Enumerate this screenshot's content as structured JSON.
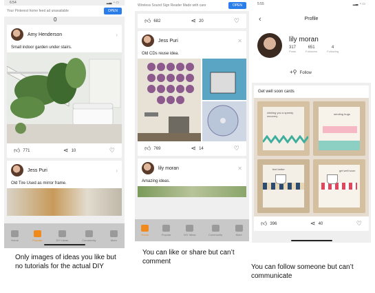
{
  "phone1": {
    "status_time": "6:54",
    "ad_text": "Your Pinterest home feed ad unavailable",
    "ad_button": "OPEN",
    "stray_char": "0",
    "post1": {
      "user": "Amy Henderson",
      "text": "Small indoor garden under stairs.",
      "likes": "771",
      "shares": "10"
    },
    "post2": {
      "user": "Jess Puri",
      "text": "Old Tire Used as mirror frame."
    },
    "tabs": [
      "Home",
      "Popular",
      "DIY Ideas",
      "Community",
      "More"
    ],
    "caption": "Only images of ideas you like but no tutorials for the actual DIY"
  },
  "phone2": {
    "ad_text": "Wireless Sound Sign Reader Made with care",
    "ad_button": "OPEN",
    "post0": {
      "likes": "682",
      "shares": "20"
    },
    "post1": {
      "user": "Jess Puri",
      "text": "Old CDs reuse idea.",
      "likes": "769",
      "shares": "14"
    },
    "post2": {
      "user": "lily moran",
      "text": "Amazing ideas."
    },
    "tabs": [
      "Home",
      "Popular",
      "DIY Ideas",
      "Community",
      "More"
    ],
    "caption": "You can like or share but can’t comment"
  },
  "phone3": {
    "status_time": "5:55",
    "title": "Profile",
    "name": "lily moran",
    "stats": [
      {
        "value": "317",
        "label": "Posts"
      },
      {
        "value": "651",
        "label": "Followers"
      },
      {
        "value": "4",
        "label": "Following"
      }
    ],
    "follow_label": "Follow",
    "post": {
      "text": "Get well soon cards",
      "likes": "396",
      "shares": "40"
    },
    "card_texts": [
      "wishing you a speedy recovery",
      "sending hugs",
      "feel better",
      "get well soon"
    ],
    "caption": "You can follow someone but can’t communicate"
  },
  "colors": {
    "accent": "#f08a1c",
    "ad_button": "#2b7de9",
    "tabbar": "#c8c8c8"
  }
}
